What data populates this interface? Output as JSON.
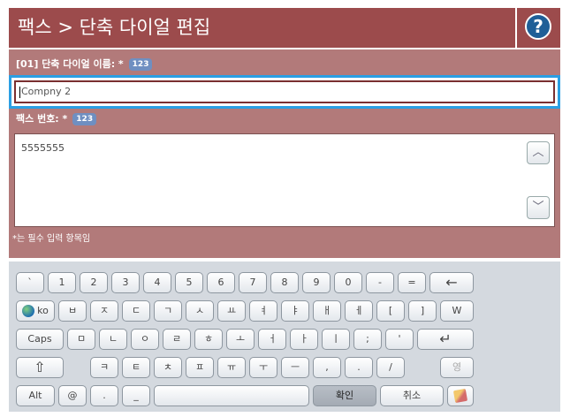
{
  "header": {
    "title": "팩스 > 단축 다이얼 편집",
    "help_label": "?"
  },
  "form": {
    "name_label": "[01] 단축 다이얼 이름: *",
    "name_badge": "123",
    "name_value": "Compny 2",
    "fax_label": "팩스 번호: *",
    "fax_badge": "123",
    "fax_value": "5555555",
    "required_note": "*는 필수 입력 항목임"
  },
  "keyboard": {
    "row1": [
      "`",
      "1",
      "2",
      "3",
      "4",
      "5",
      "6",
      "7",
      "8",
      "9",
      "0",
      "-",
      "=",
      "←"
    ],
    "row2": [
      "ko",
      "ㅂ",
      "ㅈ",
      "ㄷ",
      "ㄱ",
      "ㅅ",
      "ㅛ",
      "ㅕ",
      "ㅑ",
      "ㅐ",
      "ㅔ",
      "[",
      "]",
      "W"
    ],
    "row3": [
      "Caps",
      "ㅁ",
      "ㄴ",
      "ㅇ",
      "ㄹ",
      "ㅎ",
      "ㅗ",
      "ㅓ",
      "ㅏ",
      "ㅣ",
      ";",
      "'",
      "↵"
    ],
    "row4": [
      "⇧",
      "ㅋ",
      "ㅌ",
      "ㅊ",
      "ㅍ",
      "ㅠ",
      "ㅜ",
      "ㅡ",
      ",",
      ".",
      "/",
      "영"
    ],
    "row5": [
      "Alt",
      "@",
      ".",
      "_",
      "",
      "확인",
      "취소"
    ]
  },
  "colors": {
    "title_bar": "#9c4b4c",
    "form_bg": "#b27a7a",
    "focus_ring": "#2b9fe3",
    "keyboard_bg": "#d4d9df"
  },
  "icons": {
    "help": "help-icon",
    "scroll_up": "chevron-up-icon",
    "scroll_down": "chevron-down-icon",
    "globe": "globe-icon",
    "pencil": "pencil-icon"
  }
}
